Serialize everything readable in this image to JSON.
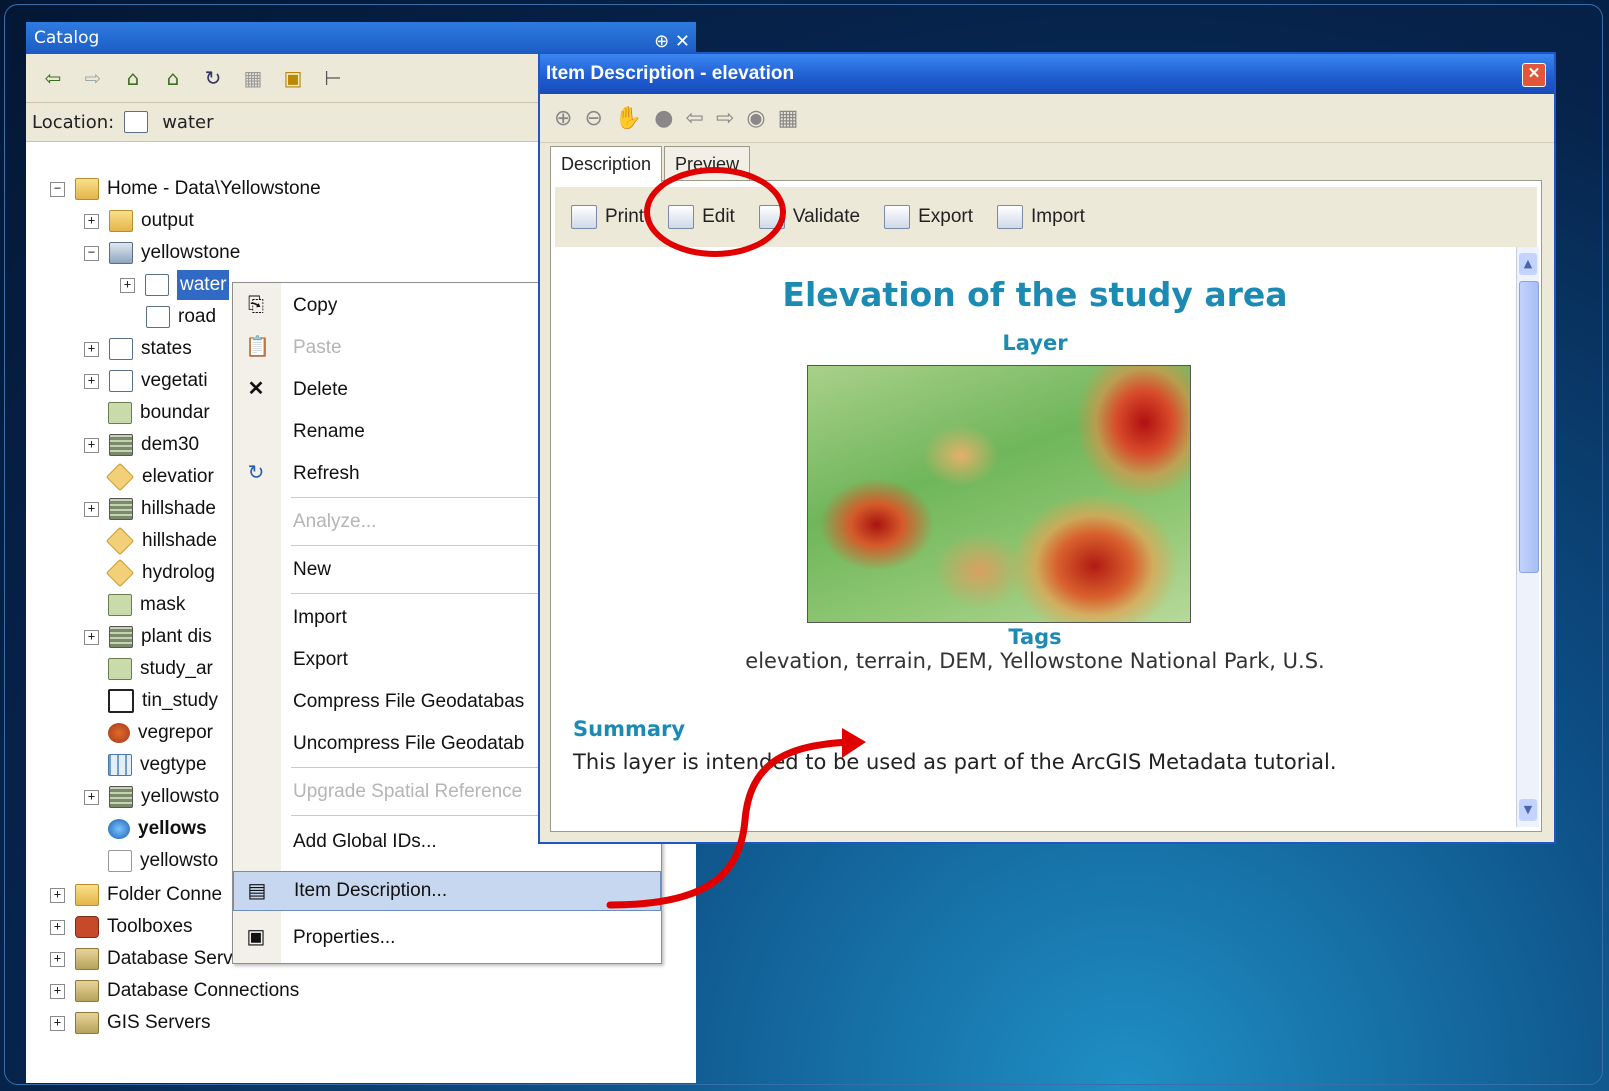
{
  "catalog": {
    "title": "Catalog",
    "titlebar_buttons": "⊕ ✕",
    "location_label": "Location:",
    "location_value": "water",
    "tree": [
      {
        "label": "Home - Data\\Yellowstone",
        "expander": "−"
      },
      {
        "label": "output",
        "expander": "+"
      },
      {
        "label": "yellowstone",
        "expander": "−"
      },
      {
        "label": "water",
        "expander": "+"
      },
      {
        "label": "road"
      },
      {
        "label": "states",
        "expander": "+"
      },
      {
        "label": "vegetati",
        "expander": "+"
      },
      {
        "label": "boundar"
      },
      {
        "label": "dem30",
        "expander": "+"
      },
      {
        "label": "elevatior"
      },
      {
        "label": "hillshade",
        "expander": "+"
      },
      {
        "label": "hillshade"
      },
      {
        "label": "hydrolog"
      },
      {
        "label": "mask"
      },
      {
        "label": "plant dis",
        "expander": "+"
      },
      {
        "label": "study_ar"
      },
      {
        "label": "tin_study"
      },
      {
        "label": "vegrepor"
      },
      {
        "label": "vegtype"
      },
      {
        "label": "yellowsto",
        "expander": "+"
      },
      {
        "label": "yellows"
      },
      {
        "label": "yellowsto"
      },
      {
        "label": "Folder Conne",
        "expander": "+"
      },
      {
        "label": "Toolboxes",
        "expander": "+"
      },
      {
        "label": "Database Servers",
        "expander": "+"
      },
      {
        "label": "Database Connections",
        "expander": "+"
      },
      {
        "label": "GIS Servers",
        "expander": "+"
      }
    ]
  },
  "context_menu": {
    "items": [
      {
        "label": "Copy"
      },
      {
        "label": "Paste"
      },
      {
        "label": "Delete"
      },
      {
        "label": "Rename"
      },
      {
        "label": "Refresh"
      },
      {
        "label": "Analyze..."
      },
      {
        "label": "New"
      },
      {
        "label": "Import"
      },
      {
        "label": "Export"
      },
      {
        "label": "Compress File Geodatabas"
      },
      {
        "label": "Uncompress File Geodatab"
      },
      {
        "label": "Upgrade Spatial Reference"
      },
      {
        "label": "Add Global IDs..."
      },
      {
        "label": "Item Description..."
      },
      {
        "label": "Properties..."
      }
    ]
  },
  "item_window": {
    "title": "Item Description - elevation",
    "close_glyph": "✕",
    "tabs": [
      "Description",
      "Preview"
    ],
    "actions": [
      "Print",
      "Edit",
      "Validate",
      "Export",
      "Import"
    ],
    "content": {
      "title": "Elevation of the study area",
      "subtitle": "Layer",
      "tags_heading": "Tags",
      "tags": "elevation, terrain, DEM, Yellowstone National Park, U.S.",
      "summary_heading": "Summary",
      "summary": "This layer is intended to be used as part of the ArcGIS Metadata tutorial."
    }
  },
  "colors": {
    "accent_heading": "#1b8bb4",
    "highlight_circle": "#e00000",
    "titlebar_blue": "#1f5cd0"
  }
}
